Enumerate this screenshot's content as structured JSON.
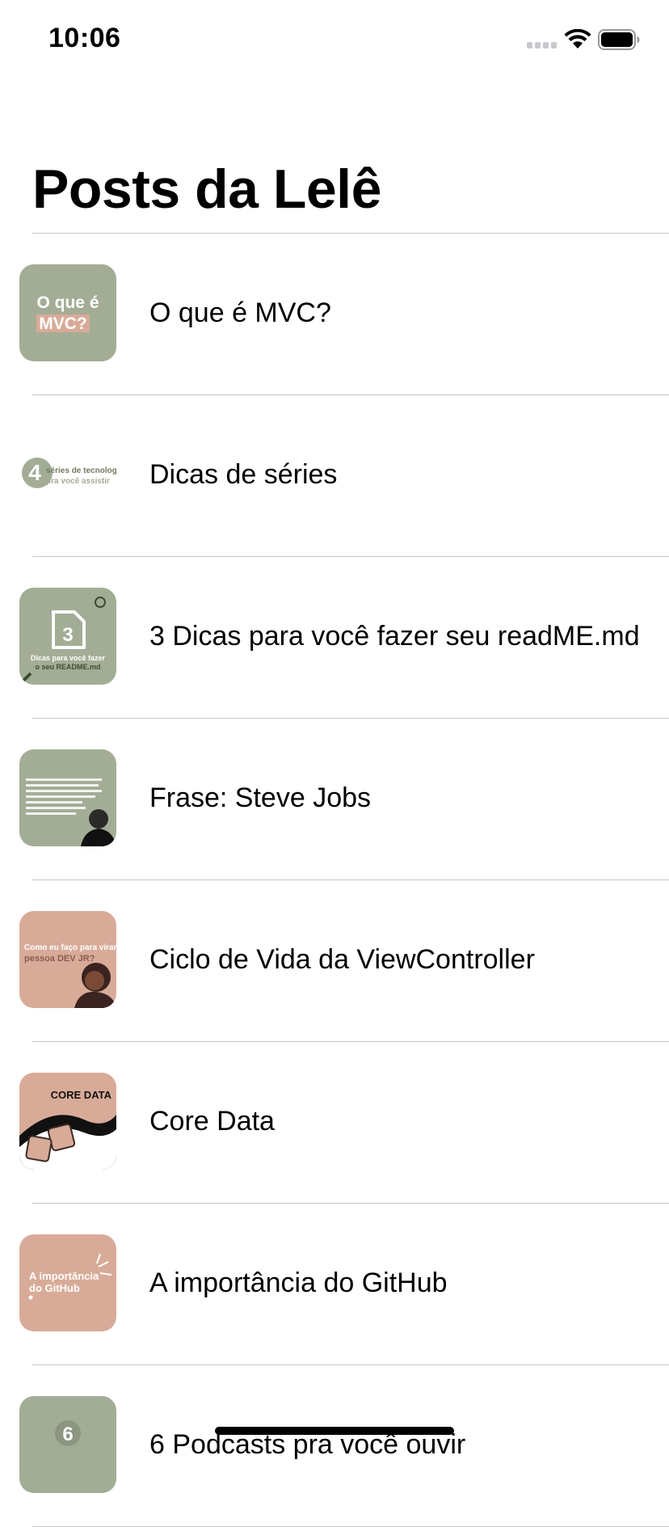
{
  "status_bar": {
    "time": "10:06"
  },
  "navigation": {
    "title": "Posts da Lelê"
  },
  "posts": [
    {
      "label": "O que é MVC?",
      "thumb_text": [
        "O que é",
        "MVC?"
      ]
    },
    {
      "label": "Dicas de séries",
      "thumb_text": [
        "4",
        "séries de tecnologia",
        "pra você assistir"
      ]
    },
    {
      "label": "3 Dicas para você fazer seu readME.md",
      "thumb_text": [
        "3",
        "Dicas para você fazer",
        "o seu README.md"
      ]
    },
    {
      "label": "Frase: Steve Jobs"
    },
    {
      "label": "Ciclo de Vida da ViewController",
      "thumb_text": [
        "Como eu faço para virar uma",
        "pessoa DEV JR?"
      ]
    },
    {
      "label": "Core Data",
      "thumb_text": [
        "CORE DATA"
      ]
    },
    {
      "label": "A importância do GitHub",
      "thumb_text": [
        "A importância",
        "do GitHub"
      ]
    },
    {
      "label": "6 Podcasts pra você ouvir",
      "thumb_text": [
        "6"
      ]
    }
  ],
  "colors": {
    "sage": "#a3ad96",
    "peach": "#d8ab98",
    "separator": "#c6c6c8"
  }
}
